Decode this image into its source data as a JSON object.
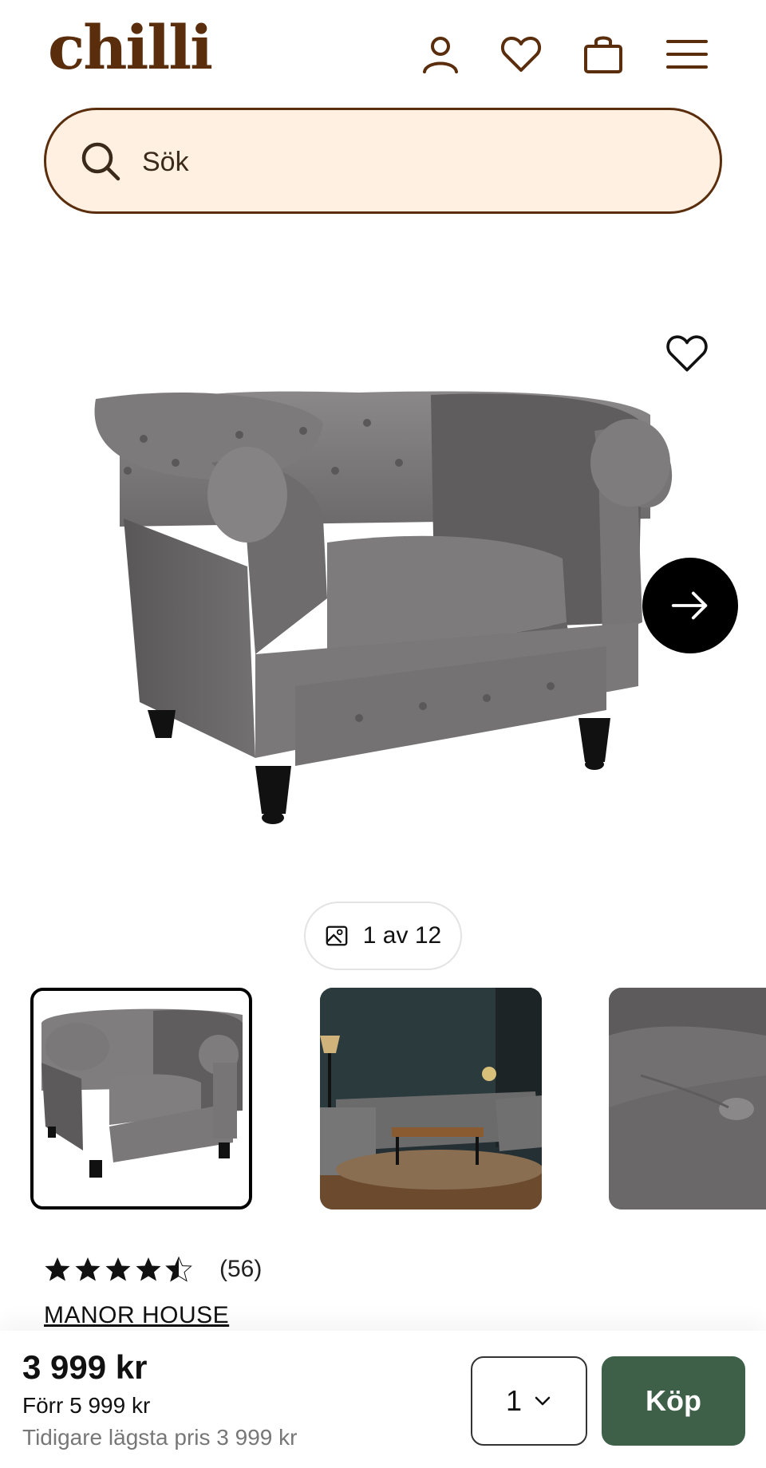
{
  "header": {
    "logo": "chilli",
    "icons": [
      "account-icon",
      "heart-icon",
      "bag-icon",
      "menu-icon"
    ],
    "brand_color": "#5a2d0c"
  },
  "search": {
    "placeholder": "Sök",
    "background": "#fff0e1"
  },
  "gallery": {
    "counter": "1 av 12",
    "thumbnails": [
      "armchair-front",
      "living-room-scene",
      "fabric-closeup"
    ]
  },
  "product": {
    "rating_stars": 4.5,
    "rating_count": "(56)",
    "brand": "MANOR HOUSE"
  },
  "purchase": {
    "price": "3 999 kr",
    "previous_price": "Förr 5 999 kr",
    "lowest_price": "Tidigare lägsta pris 3 999 kr",
    "quantity": "1",
    "buy_label": "Köp",
    "buy_color": "#3e5f48"
  }
}
